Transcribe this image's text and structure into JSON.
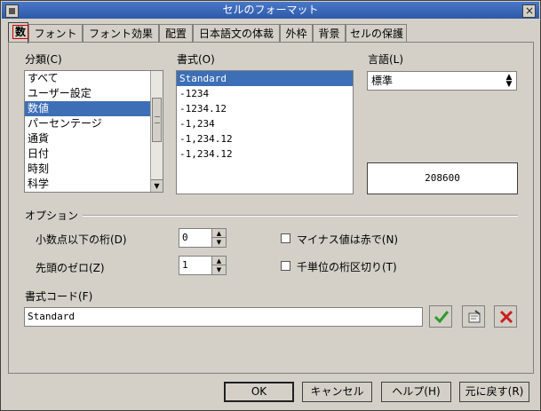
{
  "window": {
    "title": "セルのフォーマット"
  },
  "tabs": [
    {
      "label": "数",
      "active": true
    },
    {
      "label": "フォント"
    },
    {
      "label": "フォント効果"
    },
    {
      "label": "配置"
    },
    {
      "label": "日本語文の体裁"
    },
    {
      "label": "外枠"
    },
    {
      "label": "背景"
    },
    {
      "label": "セルの保護"
    }
  ],
  "category": {
    "label": "分類(C)",
    "items": [
      "すべて",
      "ユーザー設定",
      "数値",
      "パーセンテージ",
      "通貨",
      "日付",
      "時刻",
      "科学"
    ],
    "selected_index": 2
  },
  "format": {
    "label": "書式(O)",
    "items": [
      "Standard",
      "-1234",
      "-1234.12",
      "-1,234",
      "-1,234.12",
      "-1,234.12"
    ],
    "selected_index": 0
  },
  "language": {
    "label": "言語(L)",
    "value": "標準"
  },
  "preview": {
    "value": "208600"
  },
  "options": {
    "label": "オプション",
    "decimal_places": {
      "label": "小数点以下の桁(D)",
      "value": "0"
    },
    "leading_zeros": {
      "label": "先頭のゼロ(Z)",
      "value": "1"
    },
    "negative_red": {
      "label": "マイナス値は赤で(N)",
      "checked": false
    },
    "thousands_sep": {
      "label": "千単位の桁区切り(T)",
      "checked": false
    }
  },
  "format_code": {
    "label": "書式コード(F)",
    "value": "Standard"
  },
  "buttons": {
    "ok": "OK",
    "cancel": "キャンセル",
    "help": "ヘルプ(H)",
    "reset": "元に戻す(R)"
  },
  "colors": {
    "selection": "#3d6fb7",
    "titlebar": "#2c5aa8",
    "accept": "#2e9a2e",
    "delete": "#c82020"
  }
}
